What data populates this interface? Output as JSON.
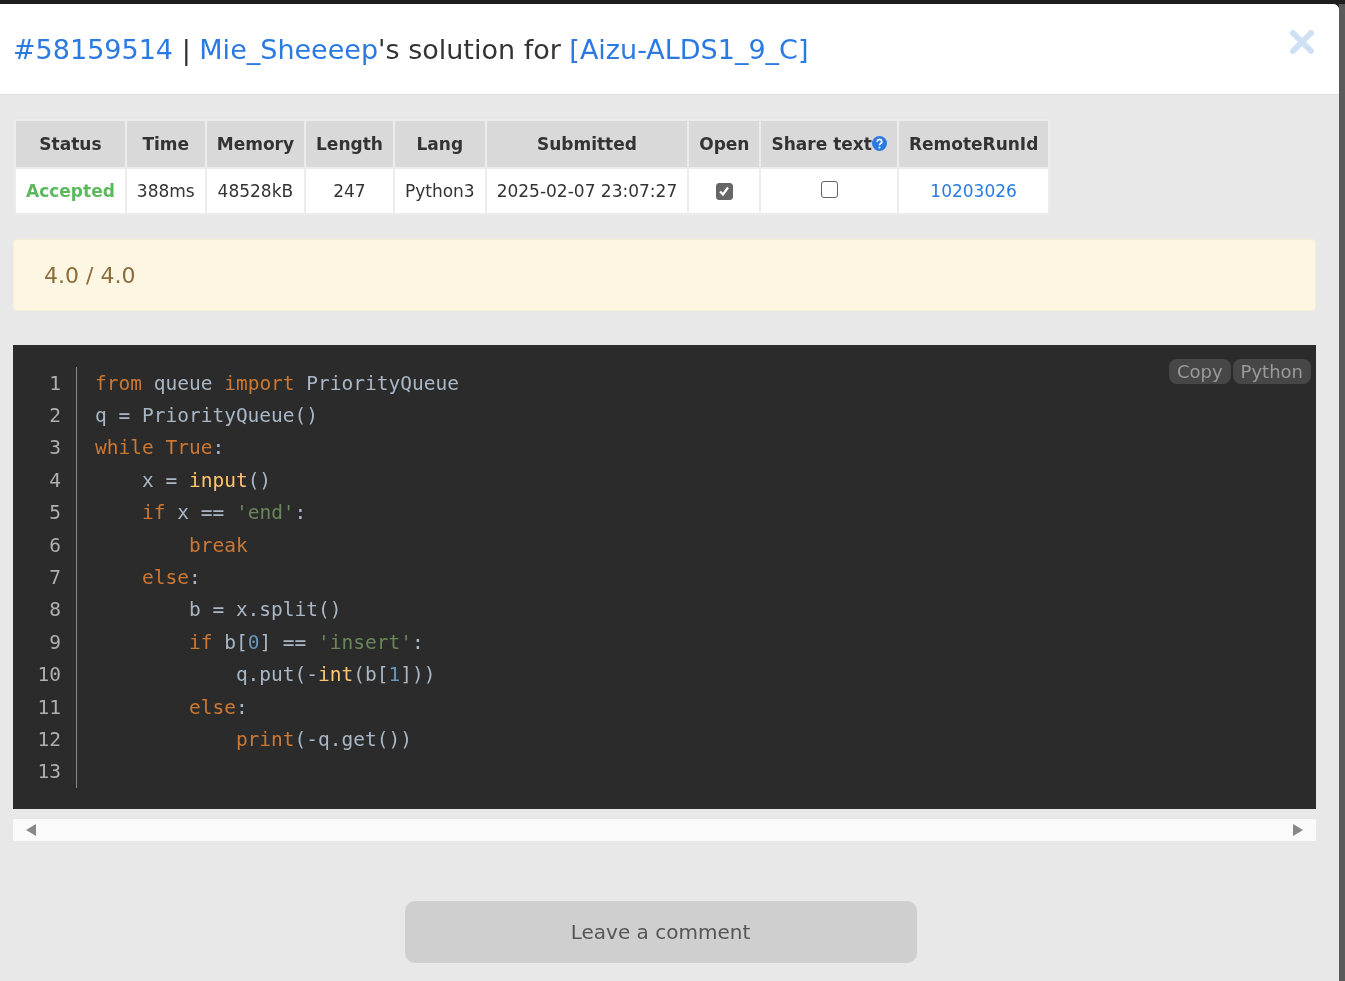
{
  "header": {
    "run_id": "#58159514",
    "separator": "|",
    "user": "Mie_Sheeeep",
    "middle": "'s solution for",
    "problem": "[Aizu-ALDS1_9_C]"
  },
  "table": {
    "columns": [
      {
        "label": "Status"
      },
      {
        "label": "Time"
      },
      {
        "label": "Memory"
      },
      {
        "label": "Length"
      },
      {
        "label": "Lang"
      },
      {
        "label": "Submitted"
      },
      {
        "label": "Open"
      },
      {
        "label": "Share text",
        "help": true
      },
      {
        "label": "RemoteRunId"
      }
    ],
    "row": {
      "status": "Accepted",
      "time": "388ms",
      "memory": "48528kB",
      "length": "247",
      "lang": "Python3",
      "submitted": "2025-02-07 23:07:27",
      "open": {
        "checked": true
      },
      "share_text": {
        "checked": false
      },
      "remote_run_id": "10203026"
    }
  },
  "score": "4.0 / 4.0",
  "code": {
    "copy_button": "Copy",
    "language_button": "Python",
    "lines": [
      {
        "number": "1",
        "tokens": [
          {
            "t": "from",
            "kind": "keyword"
          },
          {
            "t": " queue ",
            "kind": "plain"
          },
          {
            "t": "import",
            "kind": "keyword"
          },
          {
            "t": " PriorityQueue",
            "kind": "plain"
          }
        ]
      },
      {
        "number": "2",
        "tokens": [
          {
            "t": "q = PriorityQueue()",
            "kind": "plain"
          }
        ]
      },
      {
        "number": "3",
        "tokens": [
          {
            "t": "while",
            "kind": "keyword"
          },
          {
            "t": " True",
            "kind": "keyword"
          },
          {
            "t": ":",
            "kind": "plain"
          }
        ]
      },
      {
        "number": "4",
        "tokens": [
          {
            "t": "    x = ",
            "kind": "plain"
          },
          {
            "t": "input",
            "kind": "builtin"
          },
          {
            "t": "()",
            "kind": "plain"
          }
        ]
      },
      {
        "number": "5",
        "tokens": [
          {
            "t": "    if",
            "kind": "keyword"
          },
          {
            "t": " x == ",
            "kind": "plain"
          },
          {
            "t": "'end'",
            "kind": "string"
          },
          {
            "t": ":",
            "kind": "plain"
          }
        ]
      },
      {
        "number": "6",
        "tokens": [
          {
            "t": "        break",
            "kind": "keyword"
          }
        ]
      },
      {
        "number": "7",
        "tokens": [
          {
            "t": "    else",
            "kind": "keyword"
          },
          {
            "t": ":",
            "kind": "plain"
          }
        ]
      },
      {
        "number": "8",
        "tokens": [
          {
            "t": "        b = x.split()",
            "kind": "plain"
          }
        ]
      },
      {
        "number": "9",
        "tokens": [
          {
            "t": "        if",
            "kind": "keyword"
          },
          {
            "t": " b[",
            "kind": "plain"
          },
          {
            "t": "0",
            "kind": "number"
          },
          {
            "t": "] == ",
            "kind": "plain"
          },
          {
            "t": "'insert'",
            "kind": "string"
          },
          {
            "t": ":",
            "kind": "plain"
          }
        ]
      },
      {
        "number": "10",
        "tokens": [
          {
            "t": "            q.put(-",
            "kind": "plain"
          },
          {
            "t": "int",
            "kind": "builtin"
          },
          {
            "t": "(b[",
            "kind": "plain"
          },
          {
            "t": "1",
            "kind": "number"
          },
          {
            "t": "]))",
            "kind": "plain"
          }
        ]
      },
      {
        "number": "11",
        "tokens": [
          {
            "t": "        else",
            "kind": "keyword"
          },
          {
            "t": ":",
            "kind": "plain"
          }
        ]
      },
      {
        "number": "12",
        "tokens": [
          {
            "t": "            print",
            "kind": "keyword"
          },
          {
            "t": "(-q.get())",
            "kind": "plain"
          }
        ]
      },
      {
        "number": "13"
      }
    ]
  },
  "comment_button": "Leave a comment"
}
